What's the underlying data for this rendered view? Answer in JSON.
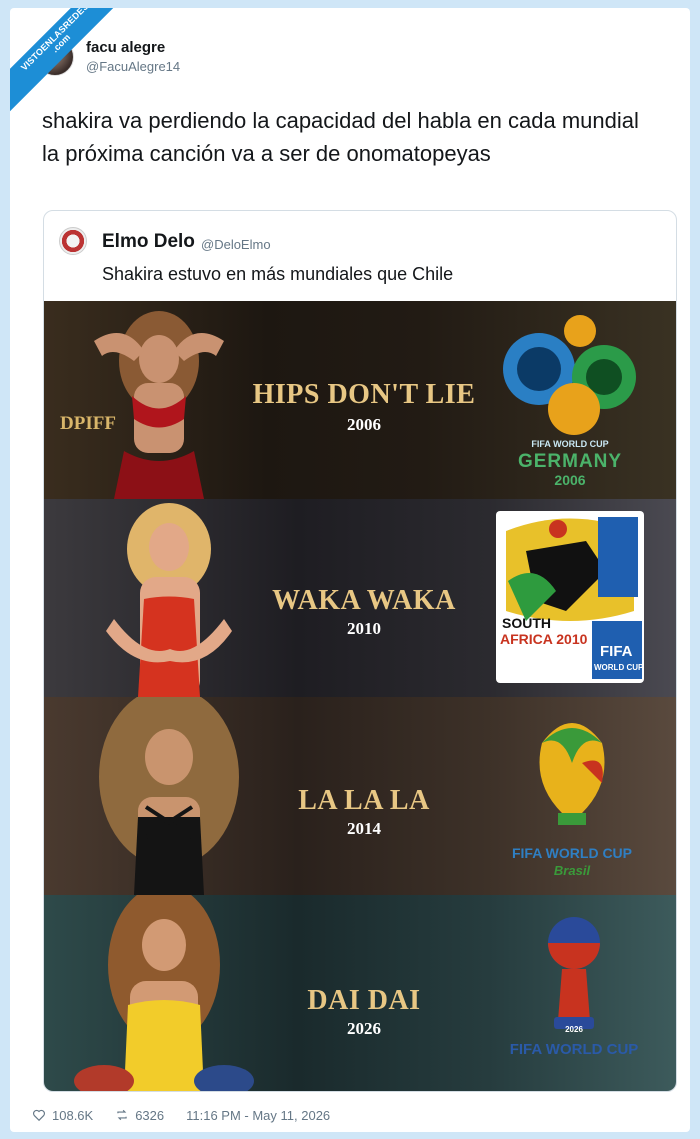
{
  "watermark": {
    "line1": "VISTOENLASREDES",
    "line2": ".com"
  },
  "tweet": {
    "author_name": "facu alegre",
    "author_handle": "@FacuAlegre14",
    "text": "shakira va perdiendo la capacidad del habla en cada mundial la próxima canción va a ser de onomatopeyas"
  },
  "quoted": {
    "author_name": "Elmo Delo",
    "author_handle": "@DeloElmo",
    "text": "Shakira estuvo en más mundiales que Chile"
  },
  "panels": [
    {
      "song": "HIPS DON'T LIE",
      "year": "2006",
      "badge": "DPIFF",
      "logo_line1": "FIFA WORLD CUP",
      "logo_line2": "GERMANY",
      "logo_line3": "2006"
    },
    {
      "song": "WAKA WAKA",
      "year": "2010",
      "logo_line1": "SOUTH",
      "logo_line2": "AFRICA 2010",
      "logo_line3": "FIFA",
      "logo_line4": "WORLD CUP"
    },
    {
      "song": "LA LA LA",
      "year": "2014",
      "logo_line1": "FIFA WORLD CUP",
      "logo_line2": "Brasil"
    },
    {
      "song": "DAI DAI",
      "year": "2026",
      "logo_line1": "2026",
      "logo_line2": "FIFA WORLD CUP"
    }
  ],
  "stats": {
    "likes": "108.6K",
    "retweets": "6326",
    "timestamp": "11:16 PM - May 11, 2026"
  },
  "colors": {
    "background": "#cfe6f7",
    "ribbon": "#1d8ed6",
    "song_gold": "#e8c784"
  }
}
